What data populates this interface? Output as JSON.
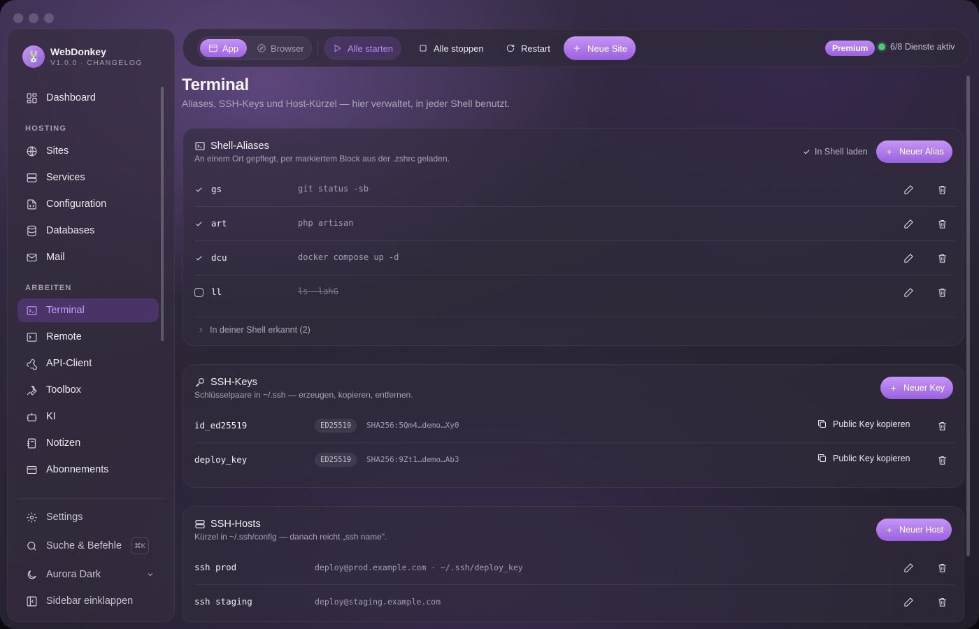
{
  "app": {
    "name": "WebDonkey",
    "version": "V1.0.0 · CHANGELOG",
    "accent": "#a874e8",
    "status_color": "#49c77d"
  },
  "sidebar": {
    "dashboard": "Dashboard",
    "section_hosting": "HOSTING",
    "hosting_items": [
      {
        "label": "Sites",
        "icon": "globe-icon"
      },
      {
        "label": "Services",
        "icon": "server-icon"
      },
      {
        "label": "Configuration",
        "icon": "file-code-icon"
      },
      {
        "label": "Databases",
        "icon": "database-icon"
      },
      {
        "label": "Mail",
        "icon": "mail-icon"
      }
    ],
    "section_work": "ARBEITEN",
    "work_items": [
      {
        "label": "Terminal",
        "icon": "terminal-icon",
        "active": true
      },
      {
        "label": "Remote",
        "icon": "remote-terminal-icon"
      },
      {
        "label": "API-Client",
        "icon": "webhook-icon"
      },
      {
        "label": "Toolbox",
        "icon": "wrench-icon"
      },
      {
        "label": "KI",
        "icon": "bot-icon"
      },
      {
        "label": "Notizen",
        "icon": "notebook-icon"
      },
      {
        "label": "Abonnements",
        "icon": "credit-card-icon"
      }
    ],
    "settings": "Settings",
    "search": "Suche & Befehle",
    "search_shortcut": "⌘K",
    "theme": "Aurora Dark",
    "collapse": "Sidebar einklappen"
  },
  "toolbar": {
    "seg_app": "App",
    "seg_browser": "Browser",
    "start_all": "Alle starten",
    "stop_all": "Alle stoppen",
    "restart": "Restart",
    "new_site": "Neue Site",
    "premium": "Premium",
    "services_status": "6/8 Dienste aktiv"
  },
  "page": {
    "title": "Terminal",
    "subtitle": "Aliases, SSH-Keys und Host-Kürzel — hier verwaltet, in jeder Shell benutzt."
  },
  "aliases": {
    "title": "Shell-Aliases",
    "desc": "An einem Ort gepflegt, per markiertem Block aus der .zshrc geladen.",
    "load_in_shell": "In Shell laden",
    "new_button": "Neuer Alias",
    "rows": [
      {
        "name": "gs",
        "command": "git status -sb",
        "enabled": true
      },
      {
        "name": "art",
        "command": "php artisan",
        "enabled": true
      },
      {
        "name": "dcu",
        "command": "docker compose up -d",
        "enabled": true
      },
      {
        "name": "ll",
        "command": "ls -lahG",
        "enabled": false
      }
    ],
    "detected": "In deiner Shell erkannt (2)"
  },
  "ssh_keys": {
    "title": "SSH-Keys",
    "desc": "Schlüsselpaare in ~/.ssh — erzeugen, kopieren, entfernen.",
    "new_button": "Neuer Key",
    "copy_label": "Public Key kopieren",
    "rows": [
      {
        "name": "id_ed25519",
        "type": "ED25519",
        "fingerprint": "SHA256:5Qm4…demo…Xy0"
      },
      {
        "name": "deploy_key",
        "type": "ED25519",
        "fingerprint": "SHA256:9Zt1…demo…Ab3"
      }
    ]
  },
  "ssh_hosts": {
    "title": "SSH-Hosts",
    "desc": "Kürzel in ~/.ssh/config — danach reicht „ssh name\".",
    "new_button": "Neuer Host",
    "rows": [
      {
        "name": "ssh prod",
        "target": "deploy@prod.example.com · ~/.ssh/deploy_key"
      },
      {
        "name": "ssh staging",
        "target": "deploy@staging.example.com"
      }
    ]
  }
}
